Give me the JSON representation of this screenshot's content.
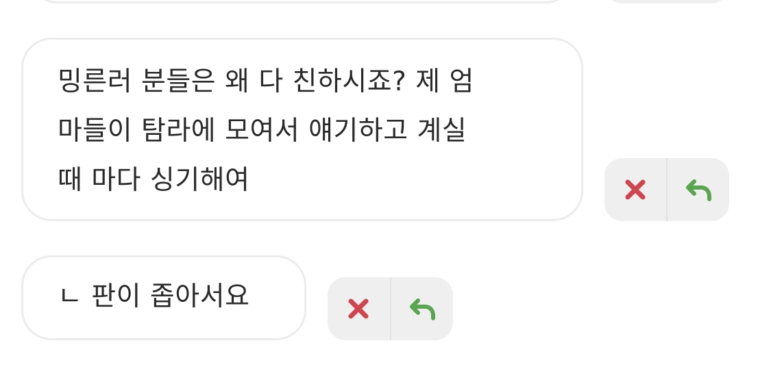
{
  "messages": [
    {
      "lines": [
        "밍른러 분들은 왜 다 친하시죠? 제 엄",
        "마들이 탐라에 모여서 얘기하고 계실",
        "때 마다 싱기해여"
      ],
      "actions": {
        "delete_icon": "x-icon",
        "reply_icon": "reply-arrow-icon"
      }
    },
    {
      "lines": [
        "ㄴ 판이 좁아서요"
      ],
      "actions": {
        "delete_icon": "x-icon",
        "reply_icon": "reply-arrow-icon"
      }
    }
  ],
  "colors": {
    "delete": "#d0454f",
    "reply": "#5aa54f",
    "bubble_border": "#ececec",
    "actions_bg": "#efefef"
  }
}
